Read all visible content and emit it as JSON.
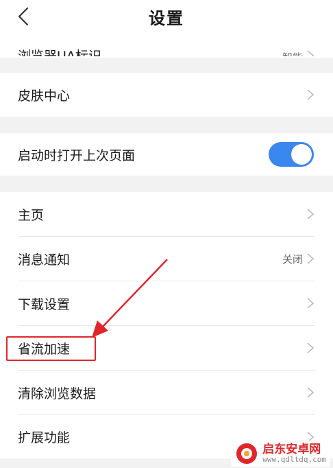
{
  "header": {
    "title": "设置"
  },
  "rows": {
    "partial": {
      "label": "浏览器UA标识",
      "value": "智能"
    },
    "skin": {
      "label": "皮肤中心"
    },
    "restore": {
      "label": "启动时打开上次页面",
      "enabled": true
    },
    "home": {
      "label": "主页"
    },
    "notify": {
      "label": "消息通知",
      "value": "关闭"
    },
    "download": {
      "label": "下载设置"
    },
    "accelerate": {
      "label": "省流加速"
    },
    "clear": {
      "label": "清除浏览数据"
    },
    "extensions": {
      "label": "扩展功能"
    }
  },
  "colors": {
    "toggle_on": "#3b87f0",
    "annotation": "#e0262a"
  },
  "watermark": {
    "title": "启东安卓网",
    "url": "www.qdltdq.com"
  }
}
